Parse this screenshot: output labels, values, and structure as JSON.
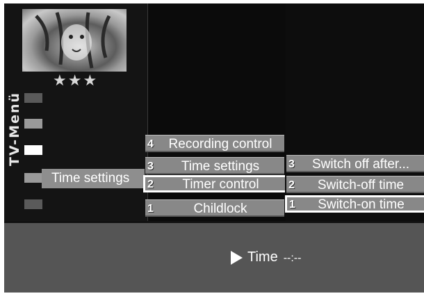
{
  "sidebar": {
    "title": "TV-Menü",
    "rating_stars": "★★★",
    "breadcrumb": "Time settings"
  },
  "menu_main": {
    "items": [
      {
        "num": "4",
        "label": "Recording control"
      },
      {
        "num": "3",
        "label": "Time settings"
      },
      {
        "num": "2",
        "label": "Timer control"
      },
      {
        "num": "1",
        "label": "Childlock"
      }
    ]
  },
  "menu_sub": {
    "items": [
      {
        "num": "3",
        "label": "Switch off after..."
      },
      {
        "num": "2",
        "label": "Switch-off time"
      },
      {
        "num": "1",
        "label": "Switch-on time"
      }
    ]
  },
  "info": {
    "label": "Time",
    "value": "--:--"
  }
}
